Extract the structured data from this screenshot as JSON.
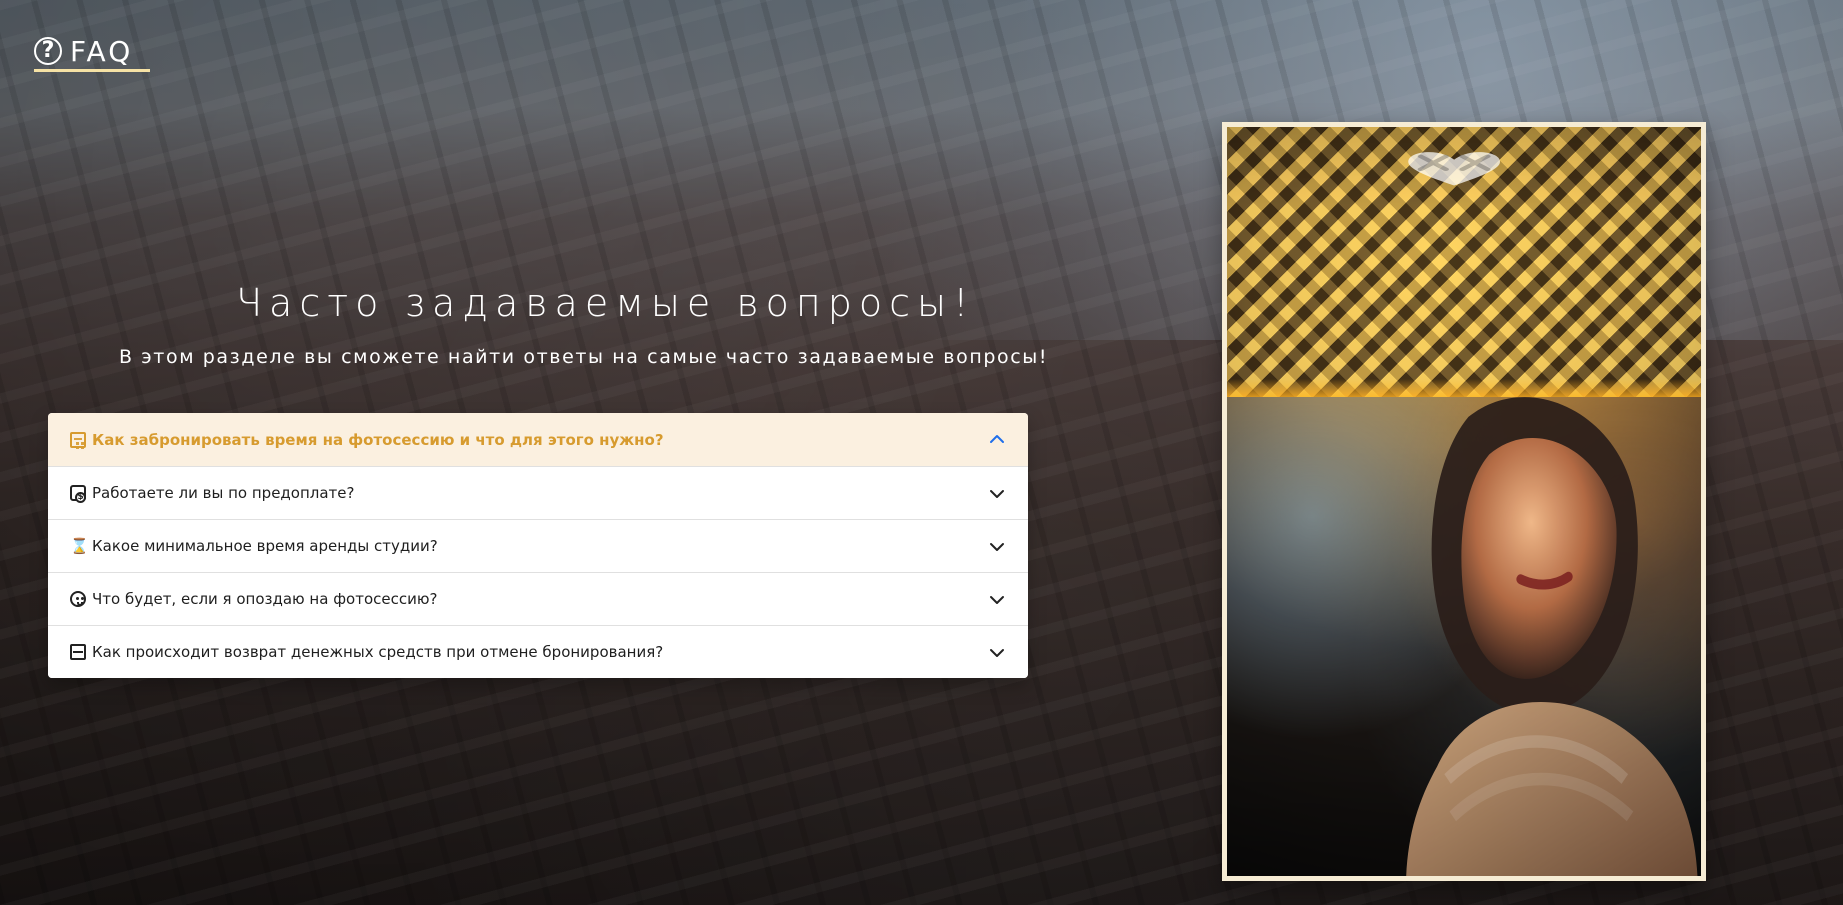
{
  "brand": {
    "logo_text": "FAQ",
    "logo_mark": "?",
    "underline_color": "#F6E2A5"
  },
  "hero": {
    "title": "Часто задаваемые вопросы!",
    "subtitle": "В этом разделе вы сможете найти ответы на самые часто задаваемые вопросы!"
  },
  "faq": {
    "accent_color": "#D79B2F",
    "active_bg": "#FBF0E0",
    "items": [
      {
        "label": "Как забронировать время на фотосессию и что для этого нужно?",
        "icon": "calendar-icon",
        "expanded": true
      },
      {
        "label": "Работаете ли вы по предоплате?",
        "icon": "money-icon",
        "expanded": false
      },
      {
        "label": "Какое минимальное время аренды студии?",
        "icon": "hourglass-icon",
        "expanded": false
      },
      {
        "label": "Что будет, если я опоздаю на фотосессию?",
        "icon": "surprised-face-icon",
        "expanded": false
      },
      {
        "label": "Как происходит возврат денежных средств при отмене бронирования?",
        "icon": "credit-card-icon",
        "expanded": false
      }
    ]
  },
  "photo": {
    "frame_color": "#F6ECD4"
  }
}
